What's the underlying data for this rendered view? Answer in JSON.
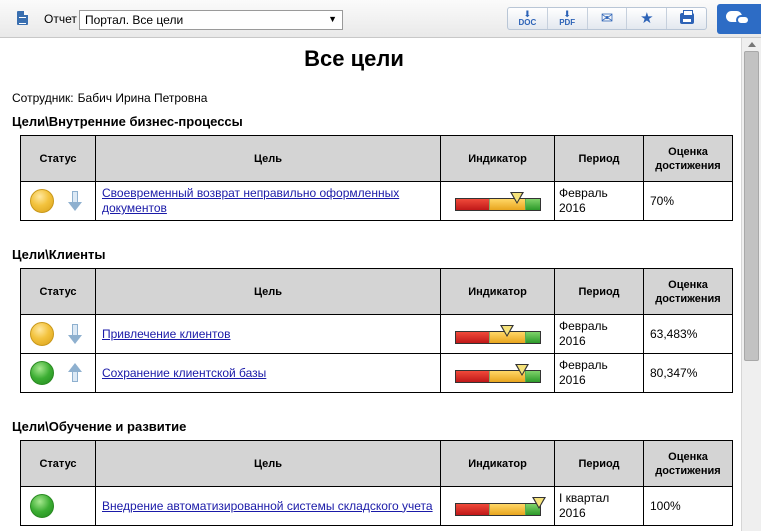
{
  "toolbar": {
    "report_label": "Отчет",
    "report_select_value": "Портал. Все цели",
    "buttons": {
      "doc": "DOC",
      "pdf": "PDF"
    },
    "icons": [
      "document-icon",
      "doc-export-icon",
      "pdf-export-icon",
      "email-icon",
      "favorite-star-icon",
      "print-icon",
      "chat-icon"
    ]
  },
  "page": {
    "title": "Все цели",
    "employee_label": "Сотрудник:",
    "employee_name": "Бабич Ирина Петровна"
  },
  "columns": {
    "status": "Статус",
    "goal": "Цель",
    "indicator": "Индикатор",
    "period": "Период",
    "score": "Оценка достижения"
  },
  "sections": [
    {
      "title": "Цели\\Внутренние бизнес-процессы",
      "rows": [
        {
          "status_color": "yellow",
          "trend": "down",
          "goal": "Своевременный возврат неправильно оформленных документов",
          "indicator_fraction": 0.72,
          "period": "Февраль 2016",
          "score": "70%"
        }
      ]
    },
    {
      "title": "Цели\\Клиенты",
      "rows": [
        {
          "status_color": "yellow",
          "trend": "down",
          "goal": "Привлечение клиентов",
          "indicator_fraction": 0.61,
          "period": "Февраль 2016",
          "score": "63,483%"
        },
        {
          "status_color": "green",
          "trend": "up",
          "goal": "Сохранение клиентской базы",
          "indicator_fraction": 0.78,
          "period": "Февраль 2016",
          "score": "80,347%"
        }
      ]
    },
    {
      "title": "Цели\\Обучение и развитие",
      "rows": [
        {
          "status_color": "green",
          "trend": "none",
          "goal": "Внедрение автоматизированной системы складского учета",
          "indicator_fraction": 0.98,
          "period": "I квартал 2016",
          "score": "100%"
        }
      ]
    }
  ],
  "colors": {
    "header_bg": "#d4d4d4",
    "link": "#1a1aa8",
    "accent": "#2d6cc5",
    "status_yellow": "#f3c33e",
    "status_green": "#3cae33"
  }
}
